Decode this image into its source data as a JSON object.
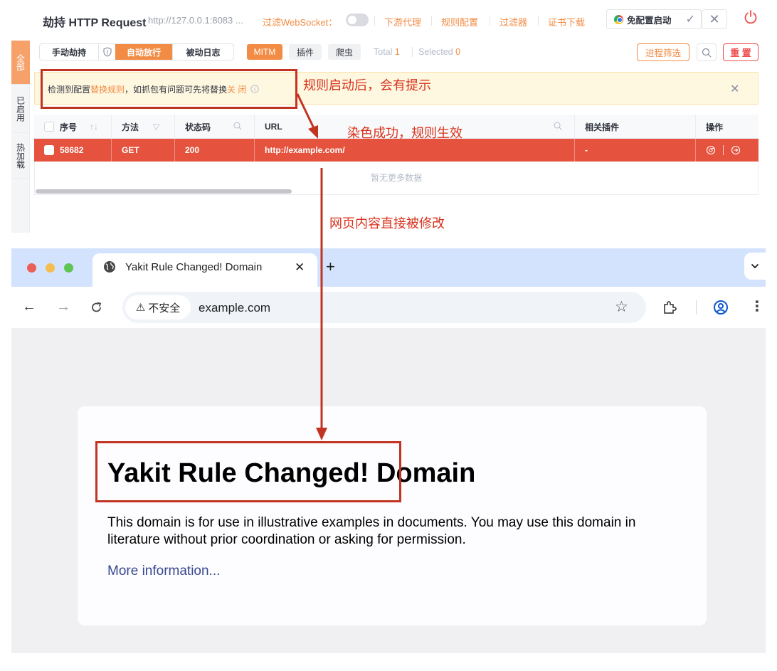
{
  "yakit": {
    "title": "劫持 HTTP Request",
    "address": "http://127.0.0.1:8083 ...",
    "websocket_filter_label": "过滤WebSocket：",
    "links": [
      "下游代理",
      "规则配置",
      "过滤器",
      "证书下载"
    ],
    "start_button": "免配置启动",
    "left_tabs": [
      "全部",
      "已启用",
      "热加载"
    ],
    "modes": {
      "manual": "手动劫持",
      "auto": "自动放行",
      "passive": "被动日志"
    },
    "chips": {
      "mitm": "MITM",
      "plugin": "插件",
      "crawler": "爬虫"
    },
    "stats": {
      "total_label": "Total",
      "total": "1",
      "selected_label": "Selected",
      "selected": "0"
    },
    "process_filter": "进程筛选",
    "reset": "重 置",
    "notice": {
      "prefix": "检测到配置",
      "rule_link": "替换规则",
      "middle": "，如抓包有问题可先将替换",
      "close_link": "关 闭"
    },
    "table": {
      "columns": [
        "序号",
        "方法",
        "状态码",
        "URL",
        "相关插件",
        "操作"
      ],
      "row": {
        "id": "58682",
        "method": "GET",
        "status": "200",
        "url": "http://example.com/",
        "plugins": "-"
      },
      "no_more": "暂无更多数据"
    }
  },
  "annotations": {
    "notice_hint": "规则启动后，会有提示",
    "color_hint": "染色成功，规则生效",
    "page_hint": "网页内容直接被修改"
  },
  "browser": {
    "tab_title": "Yakit Rule Changed! Domain",
    "insecure_label": "不安全",
    "url": "example.com",
    "page": {
      "heading_changed": "Yakit Rule Changed!",
      "heading_rest": "Domain",
      "paragraph": "This domain is for use in illustrative examples in documents. You may use this domain in literature without prior coordination or asking for permission.",
      "link": "More information..."
    }
  },
  "colors": {
    "accent": "#f28b44",
    "highlight_row": "#e5533e",
    "annotation": "#d8311b"
  }
}
